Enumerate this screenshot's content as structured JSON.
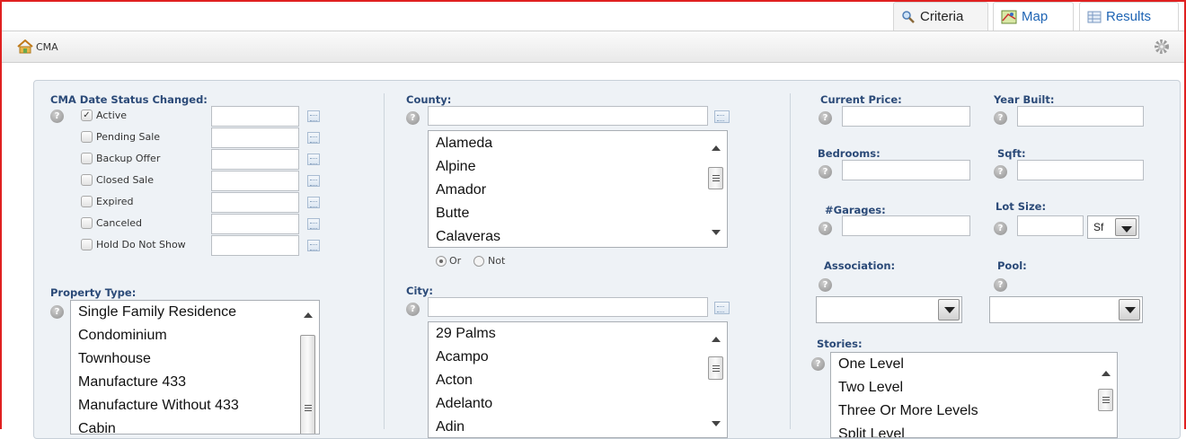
{
  "tabs": [
    {
      "label": "Criteria",
      "icon": "magnifier-icon",
      "active": true
    },
    {
      "label": "Map",
      "icon": "map-icon",
      "active": false
    },
    {
      "label": "Results",
      "icon": "grid-icon",
      "active": false
    }
  ],
  "header": {
    "title": "CMA",
    "icon": "home-icon",
    "settings_icon": "gear-icon"
  },
  "status_section": {
    "label": "CMA Date Status Changed:",
    "items": [
      {
        "label": "Active",
        "checked": true
      },
      {
        "label": "Pending Sale",
        "checked": false
      },
      {
        "label": "Backup Offer",
        "checked": false
      },
      {
        "label": "Closed Sale",
        "checked": false
      },
      {
        "label": "Expired",
        "checked": false
      },
      {
        "label": "Canceled",
        "checked": false
      },
      {
        "label": "Hold Do Not Show",
        "checked": false
      }
    ]
  },
  "property_type": {
    "label": "Property Type:",
    "options": [
      "Single Family Residence",
      "Condominium",
      "Townhouse",
      "Manufacture 433",
      "Manufacture Without 433",
      "Cabin"
    ]
  },
  "county": {
    "label": "County:",
    "value": "",
    "options": [
      "Alameda",
      "Alpine",
      "Amador",
      "Butte",
      "Calaveras"
    ],
    "mode_or": "Or",
    "mode_not": "Not",
    "mode_selected": "Or"
  },
  "city": {
    "label": "City:",
    "value": "",
    "options": [
      "29 Palms",
      "Acampo",
      "Acton",
      "Adelanto",
      "Adin"
    ]
  },
  "fields": {
    "current_price": "Current Price:",
    "year_built": "Year Built:",
    "bedrooms": "Bedrooms:",
    "sqft": "Sqft:",
    "garages": "#Garages:",
    "lot_size": "Lot Size:",
    "lot_size_unit": "Sf",
    "association": "Association:",
    "pool": "Pool:"
  },
  "stories": {
    "label": "Stories:",
    "options": [
      "One Level",
      "Two Level",
      "Three Or More Levels",
      "Split Level"
    ]
  },
  "help_glyph": "?",
  "check_glyph": "✓",
  "colors": {
    "frame": "#e02020",
    "label": "#2b4a78",
    "link": "#1e64b4"
  }
}
